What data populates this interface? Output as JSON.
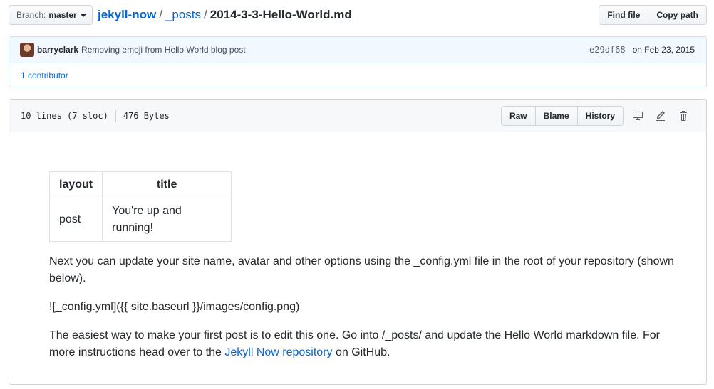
{
  "branch": {
    "label": "Branch:",
    "value": "master"
  },
  "breadcrumb": {
    "repo": "jekyll-now",
    "sep1": "/",
    "folder": "_posts",
    "sep2": "/",
    "file": "2014-3-3-Hello-World.md"
  },
  "header_buttons": {
    "find_file": "Find file",
    "copy_path": "Copy path"
  },
  "commit": {
    "author": "barryclark",
    "message": "Removing emoji from Hello World blog post",
    "sha": "e29df68",
    "date": "on Feb 23, 2015",
    "contributors": "1 contributor"
  },
  "file": {
    "lines": "10 lines (7 sloc)",
    "size": "476 Bytes",
    "buttons": {
      "raw": "Raw",
      "blame": "Blame",
      "history": "History"
    },
    "icons": [
      "desktop-icon",
      "pencil-icon",
      "trash-icon"
    ]
  },
  "content": {
    "table": {
      "headers": [
        "layout",
        "title"
      ],
      "row": [
        "post",
        "You're up and running!"
      ]
    },
    "p1": "Next you can update your site name, avatar and other options using the _config.yml file in the root of your repository (shown below).",
    "p2": "![_config.yml]({{ site.baseurl }}/images/config.png)",
    "p3_before": "The easiest way to make your first post is to edit this one. Go into /_posts/ and update the Hello World markdown file. For more instructions head over to the ",
    "p3_link": "Jekyll Now repository",
    "p3_after": " on GitHub."
  },
  "colors": {
    "link": "#0366d6",
    "text": "#24292e",
    "commit_bg": "#f1f8ff",
    "border": "#d1d5da"
  }
}
